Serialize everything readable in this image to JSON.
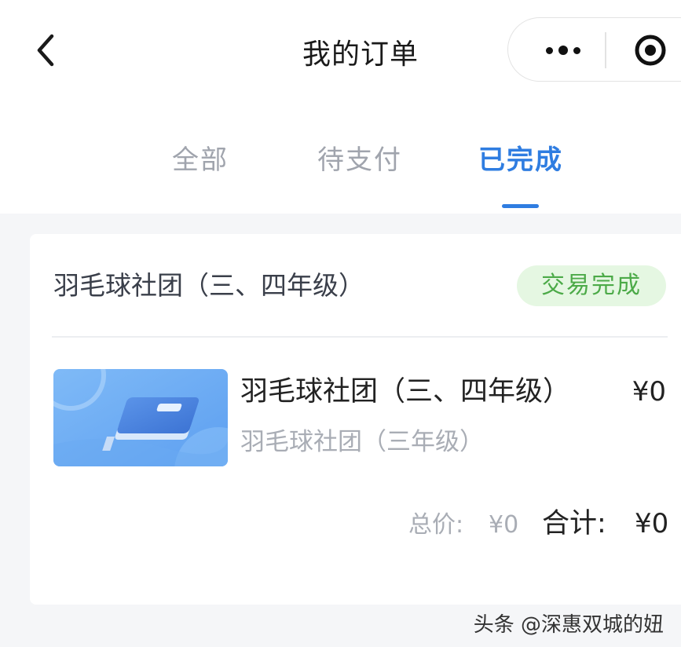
{
  "header": {
    "title": "我的订单",
    "back_icon": "chevron-left-icon",
    "more_icon": "more-dots-icon",
    "close_icon": "target-close-icon"
  },
  "tabs": [
    {
      "label": "全部",
      "active": false
    },
    {
      "label": "待支付",
      "active": false
    },
    {
      "label": "已完成",
      "active": true
    }
  ],
  "order": {
    "title": "羽毛球社团（三、四年级）",
    "status": "交易完成",
    "item": {
      "thumbnail_icon": "book-icon",
      "title": "羽毛球社团（三、四年级）",
      "subtitle": "羽毛球社团（三年级）",
      "price": "¥0"
    },
    "total_label": "总价:",
    "total_value": "¥0",
    "sum_label": "合计:",
    "sum_value": "¥0"
  },
  "watermark": "头条 @深惠双城的妞",
  "colors": {
    "accent": "#2f7de1",
    "status_green": "#4caa48",
    "status_bg": "#e5f7e2",
    "page_bg": "#f5f6f8"
  }
}
